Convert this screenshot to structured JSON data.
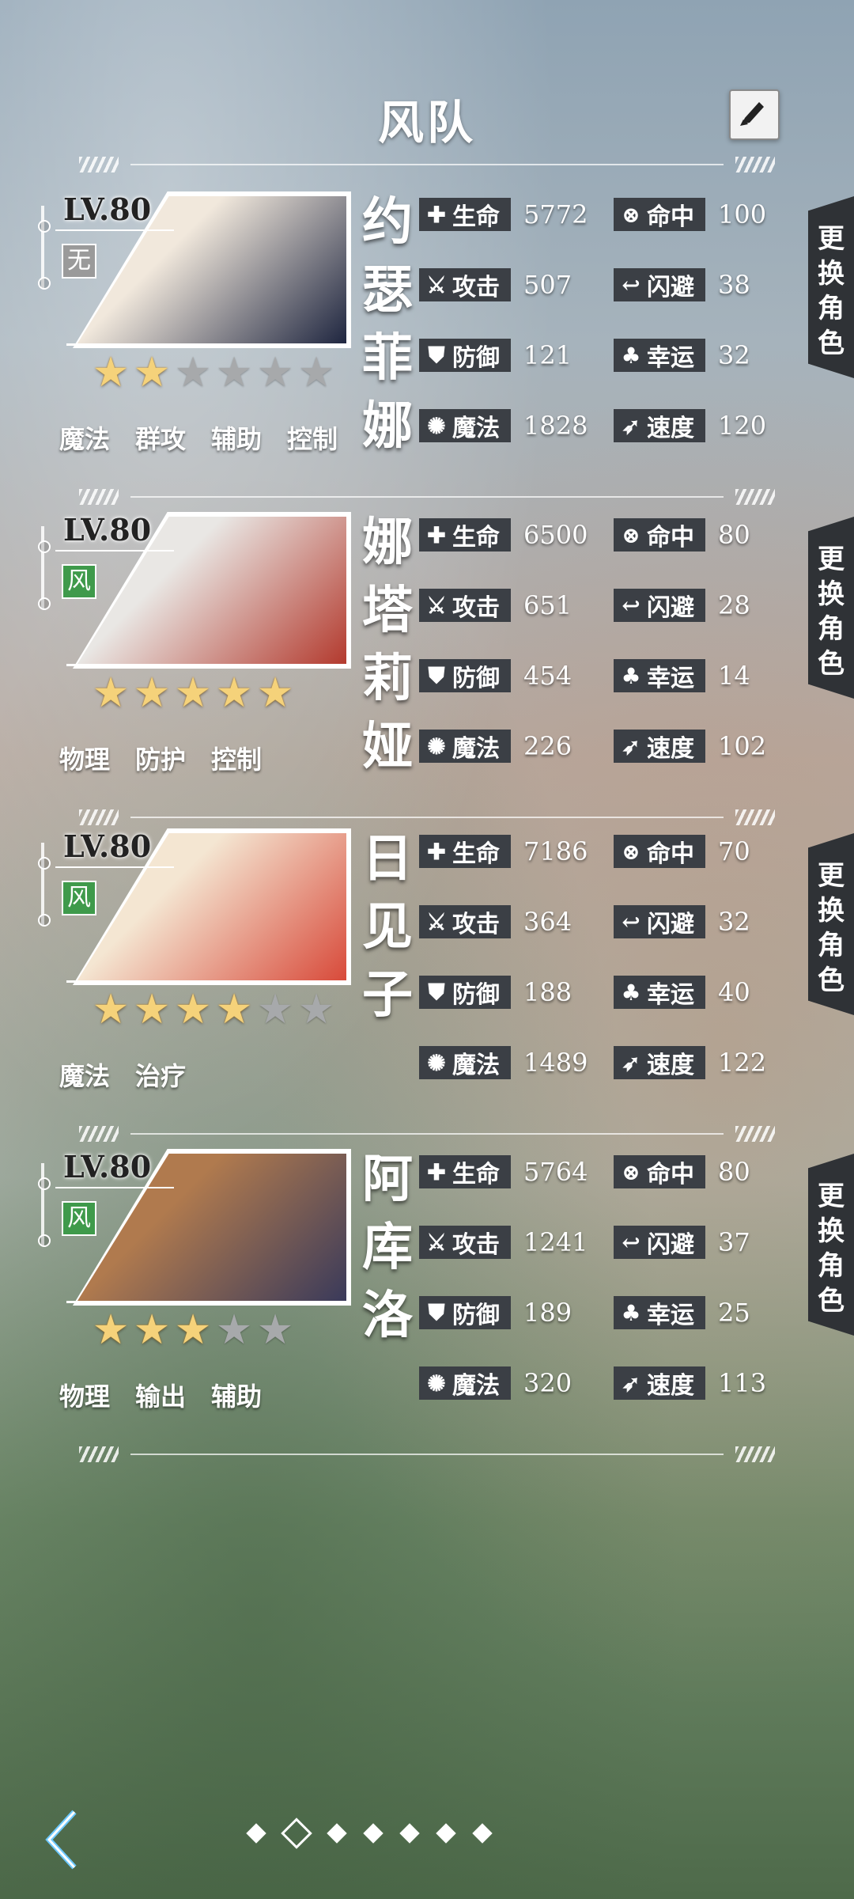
{
  "header": {
    "title": "风队"
  },
  "characters": [
    {
      "name": "约瑟菲娜",
      "level": "LV.80",
      "element": "无",
      "element_type": "none",
      "stars": 2,
      "max_stars": 6,
      "tags": [
        "魔法",
        "群攻",
        "辅助",
        "控制"
      ],
      "portrait_colors": [
        "#f1e8dc",
        "#1f2640"
      ],
      "stats": {
        "hp": "5772",
        "hit": "100",
        "atk": "507",
        "dodge": "38",
        "def": "121",
        "luck": "32",
        "mag": "1828",
        "spd": "120"
      }
    },
    {
      "name": "娜塔莉娅",
      "level": "LV.80",
      "element": "风",
      "element_type": "wind",
      "stars": 5,
      "max_stars": 5,
      "tags": [
        "物理",
        "防护",
        "控制"
      ],
      "portrait_colors": [
        "#e9e7e4",
        "#b33a2e"
      ],
      "stats": {
        "hp": "6500",
        "hit": "80",
        "atk": "651",
        "dodge": "28",
        "def": "454",
        "luck": "14",
        "mag": "226",
        "spd": "102"
      }
    },
    {
      "name": "日见子",
      "level": "LV.80",
      "element": "风",
      "element_type": "wind",
      "stars": 4,
      "max_stars": 6,
      "tags": [
        "魔法",
        "治疗"
      ],
      "portrait_colors": [
        "#f4e6d2",
        "#d84a3a"
      ],
      "stats": {
        "hp": "7186",
        "hit": "70",
        "atk": "364",
        "dodge": "32",
        "def": "188",
        "luck": "40",
        "mag": "1489",
        "spd": "122"
      }
    },
    {
      "name": "阿库洛",
      "level": "LV.80",
      "element": "风",
      "element_type": "wind",
      "stars": 3,
      "max_stars": 5,
      "tags": [
        "物理",
        "输出",
        "辅助"
      ],
      "portrait_colors": [
        "#b07a4e",
        "#3a3a5a"
      ],
      "stats": {
        "hp": "5764",
        "hit": "80",
        "atk": "1241",
        "dodge": "37",
        "def": "189",
        "luck": "25",
        "mag": "320",
        "spd": "113"
      }
    }
  ],
  "stat_labels": {
    "hp": "生命",
    "hit": "命中",
    "atk": "攻击",
    "dodge": "闪避",
    "def": "防御",
    "luck": "幸运",
    "mag": "魔法",
    "spd": "速度"
  },
  "stat_icons": {
    "hp": "plus-icon",
    "hit": "target-icon",
    "atk": "sword-icon",
    "dodge": "dodge-icon",
    "def": "shield-icon",
    "luck": "clover-icon",
    "mag": "magic-icon",
    "spd": "speed-icon"
  },
  "swap_label": "更换角色",
  "pager": {
    "count": 7,
    "active_index": 1
  },
  "colors": {
    "stat_pill": "#3b3f45",
    "wind": "#3f9a4b",
    "none": "#9a9a9a",
    "star_on": "#f5d27a",
    "star_off": "#a7a9ab"
  }
}
